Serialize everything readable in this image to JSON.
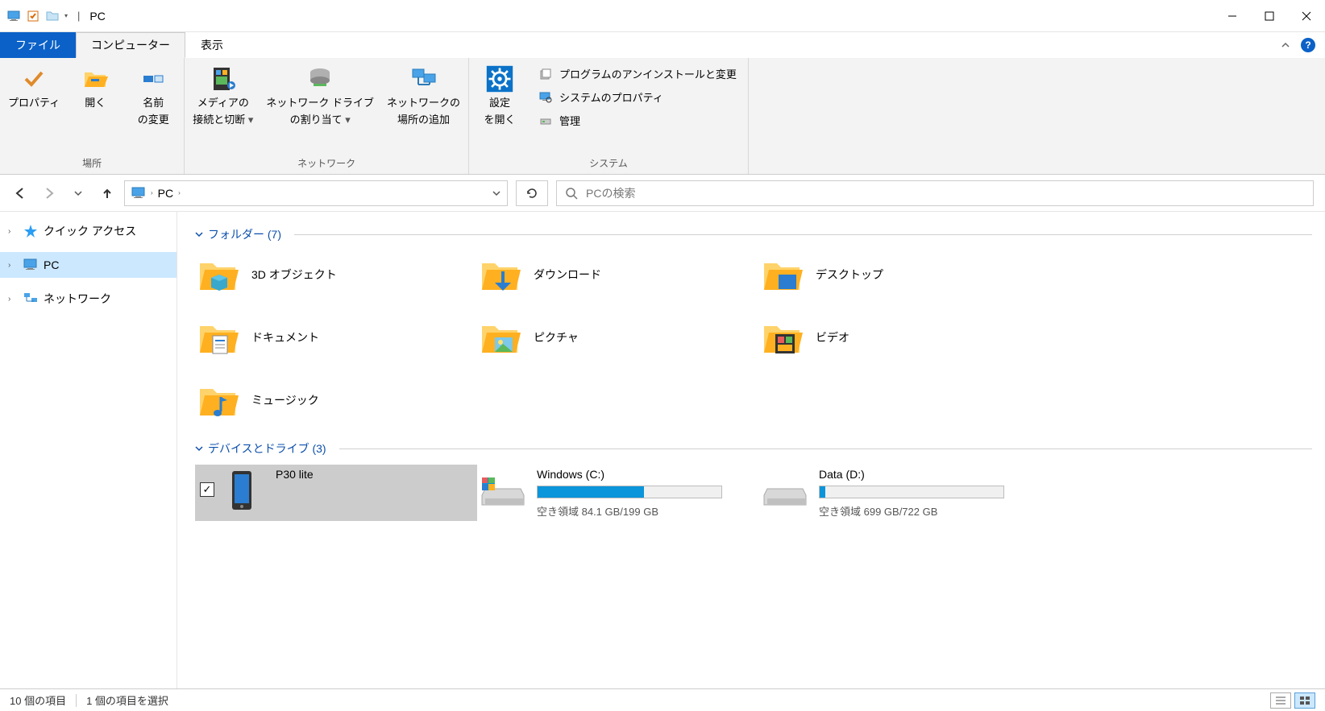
{
  "titlebar": {
    "title": "PC"
  },
  "ribbon": {
    "tabs": {
      "file": "ファイル",
      "computer": "コンピューター",
      "view": "表示"
    },
    "group_location": {
      "label": "場所",
      "properties": "プロパティ",
      "open": "開く",
      "rename1": "名前",
      "rename2": "の変更"
    },
    "group_network": {
      "label": "ネットワーク",
      "media1": "メディアの",
      "media2": "接続と切断",
      "mapdrive1": "ネットワーク ドライブ",
      "mapdrive2": "の割り当て",
      "addloc1": "ネットワークの",
      "addloc2": "場所の追加"
    },
    "group_system": {
      "label": "システム",
      "settings1": "設定",
      "settings2": "を開く",
      "uninstall": "プログラムのアンインストールと変更",
      "sysprops": "システムのプロパティ",
      "manage": "管理"
    }
  },
  "address": {
    "crumb": "PC",
    "search_placeholder": "PCの検索"
  },
  "sidebar": {
    "quick_access": "クイック アクセス",
    "pc": "PC",
    "network": "ネットワーク"
  },
  "content": {
    "folders_header": "フォルダー (7)",
    "devices_header": "デバイスとドライブ (3)",
    "folders": {
      "f0": "3D オブジェクト",
      "f1": "ダウンロード",
      "f2": "デスクトップ",
      "f3": "ドキュメント",
      "f4": "ピクチャ",
      "f5": "ビデオ",
      "f6": "ミュージック"
    },
    "drives": {
      "d0": {
        "label": "P30 lite"
      },
      "d1": {
        "label": "Windows (C:)",
        "space": "空き領域 84.1 GB/199 GB",
        "fill_pct": 58
      },
      "d2": {
        "label": "Data (D:)",
        "space": "空き領域 699 GB/722 GB",
        "fill_pct": 3
      }
    }
  },
  "statusbar": {
    "item_count": "10 個の項目",
    "selection": "1 個の項目を選択"
  }
}
